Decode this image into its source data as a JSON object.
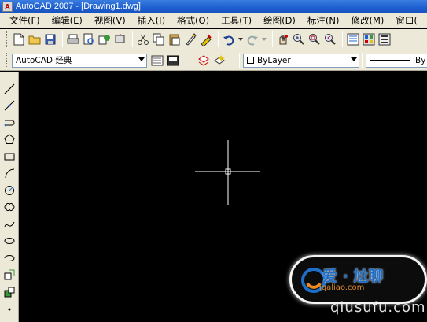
{
  "window": {
    "title": "AutoCAD 2007 - [Drawing1.dwg]",
    "app_icon_text": "A"
  },
  "menu": [
    {
      "label": "文件(F)"
    },
    {
      "label": "编辑(E)"
    },
    {
      "label": "视图(V)"
    },
    {
      "label": "插入(I)"
    },
    {
      "label": "格式(O)"
    },
    {
      "label": "工具(T)"
    },
    {
      "label": "绘图(D)"
    },
    {
      "label": "标注(N)"
    },
    {
      "label": "修改(M)"
    },
    {
      "label": "窗口("
    }
  ],
  "workspace": {
    "current": "AutoCAD 经典"
  },
  "properties": {
    "color": "ByLayer",
    "linetype": "By"
  },
  "watermark": {
    "main": "爱 ·  尬聊",
    "url": "igaliao.com",
    "footer": "qiusufu.com"
  },
  "colors": {
    "accent": "#1d5fd0",
    "canvas": "#000000",
    "crosshair": "#ffffff",
    "chrome": "#ece9d8"
  }
}
